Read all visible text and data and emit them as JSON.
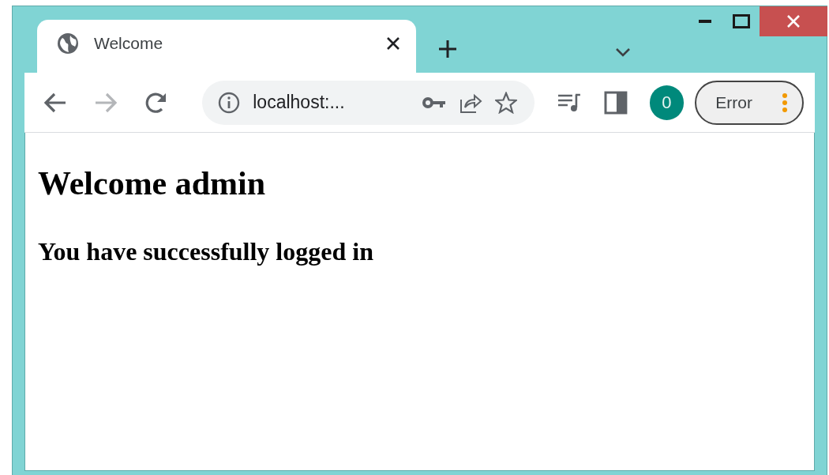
{
  "tabs": [
    {
      "title": "Welcome",
      "selected": true
    }
  ],
  "address_bar": {
    "url": "localhost:..."
  },
  "profile": {
    "initial": "0"
  },
  "error_button": {
    "label": "Error"
  },
  "page": {
    "heading": "Welcome admin",
    "subheading": "You have successfully logged in"
  }
}
